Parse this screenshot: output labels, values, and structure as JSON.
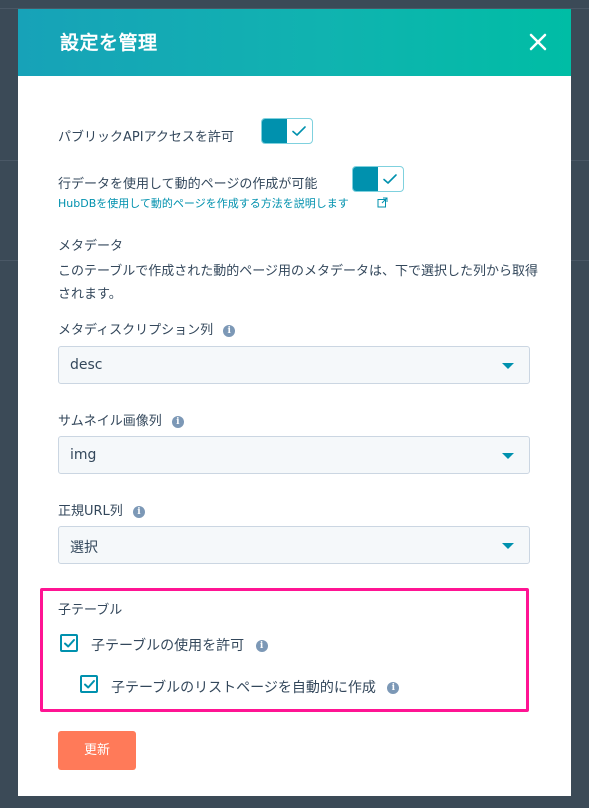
{
  "modal": {
    "title": "設定を管理",
    "close_glyph": "✕"
  },
  "public_api": {
    "label": "パブリックAPIアクセスを許可",
    "enabled": true
  },
  "dynamic_pages": {
    "label": "行データを使用して動的ページの作成が可能",
    "enabled": true,
    "help_link": "HubDBを使用して動的ページを作成する方法を説明します"
  },
  "metadata": {
    "heading": "メタデータ",
    "description": "このテーブルで作成された動的ページ用のメタデータは、下で選択した列から取得されます。"
  },
  "fields": {
    "meta_description": {
      "label": "メタディスクリプション列",
      "value": "desc"
    },
    "thumbnail": {
      "label": "サムネイル画像列",
      "value": "img"
    },
    "canonical_url": {
      "label": "正規URL列",
      "value": "選択"
    }
  },
  "child_tables": {
    "heading": "子テーブル",
    "allow_label": "子テーブルの使用を許可",
    "allow_checked": true,
    "auto_list_label": "子テーブルのリストページを自動的に作成",
    "auto_list_checked": true
  },
  "footer": {
    "update_label": "更新"
  },
  "colors": {
    "accent": "#0091ae",
    "header_start": "#17a2b8",
    "header_end": "#00bda5",
    "update_button": "#ff7a59",
    "highlight": "#ff1493"
  },
  "icons": {
    "info": "info-icon",
    "close": "close-icon",
    "external_link": "external-link-icon",
    "dropdown": "caret-down-icon",
    "check": "check-icon"
  }
}
